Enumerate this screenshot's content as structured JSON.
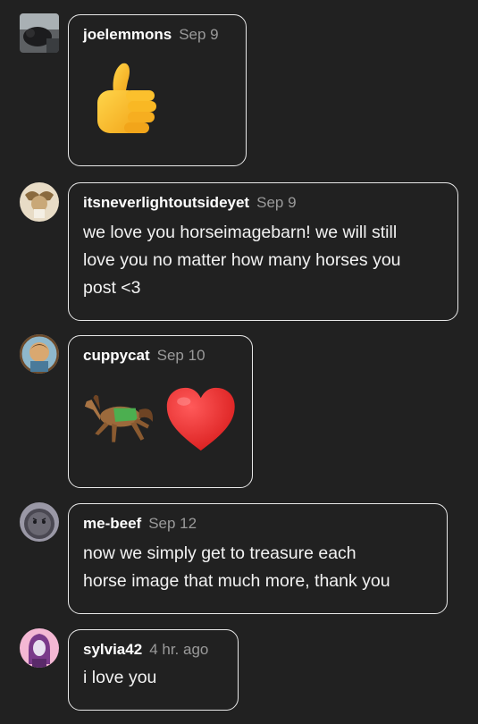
{
  "comments": [
    {
      "username": "joelemmons",
      "time": "Sep 9",
      "text": "",
      "emoji": [
        "thumbs-up-emoji"
      ]
    },
    {
      "username": "itsneverlightoutsideyet",
      "time": "Sep 9",
      "text_lines": [
        "we love you horseimagebarn! we will still",
        "love you no matter how many horses you",
        "post <3"
      ]
    },
    {
      "username": "cuppycat",
      "time": "Sep 10",
      "text": "",
      "emoji": [
        "racehorse-emoji",
        "red-heart-emoji"
      ]
    },
    {
      "username": "me-beef",
      "time": "Sep 12",
      "text_lines": [
        "now we simply get to treasure each",
        "horse image that much more, thank you"
      ]
    },
    {
      "username": "sylvia42",
      "time": "4 hr. ago",
      "text_lines": [
        "i love you"
      ]
    }
  ],
  "colors": {
    "background": "#212121",
    "bubble_border": "#e8e8e8",
    "timestamp": "#9a9a9a"
  }
}
